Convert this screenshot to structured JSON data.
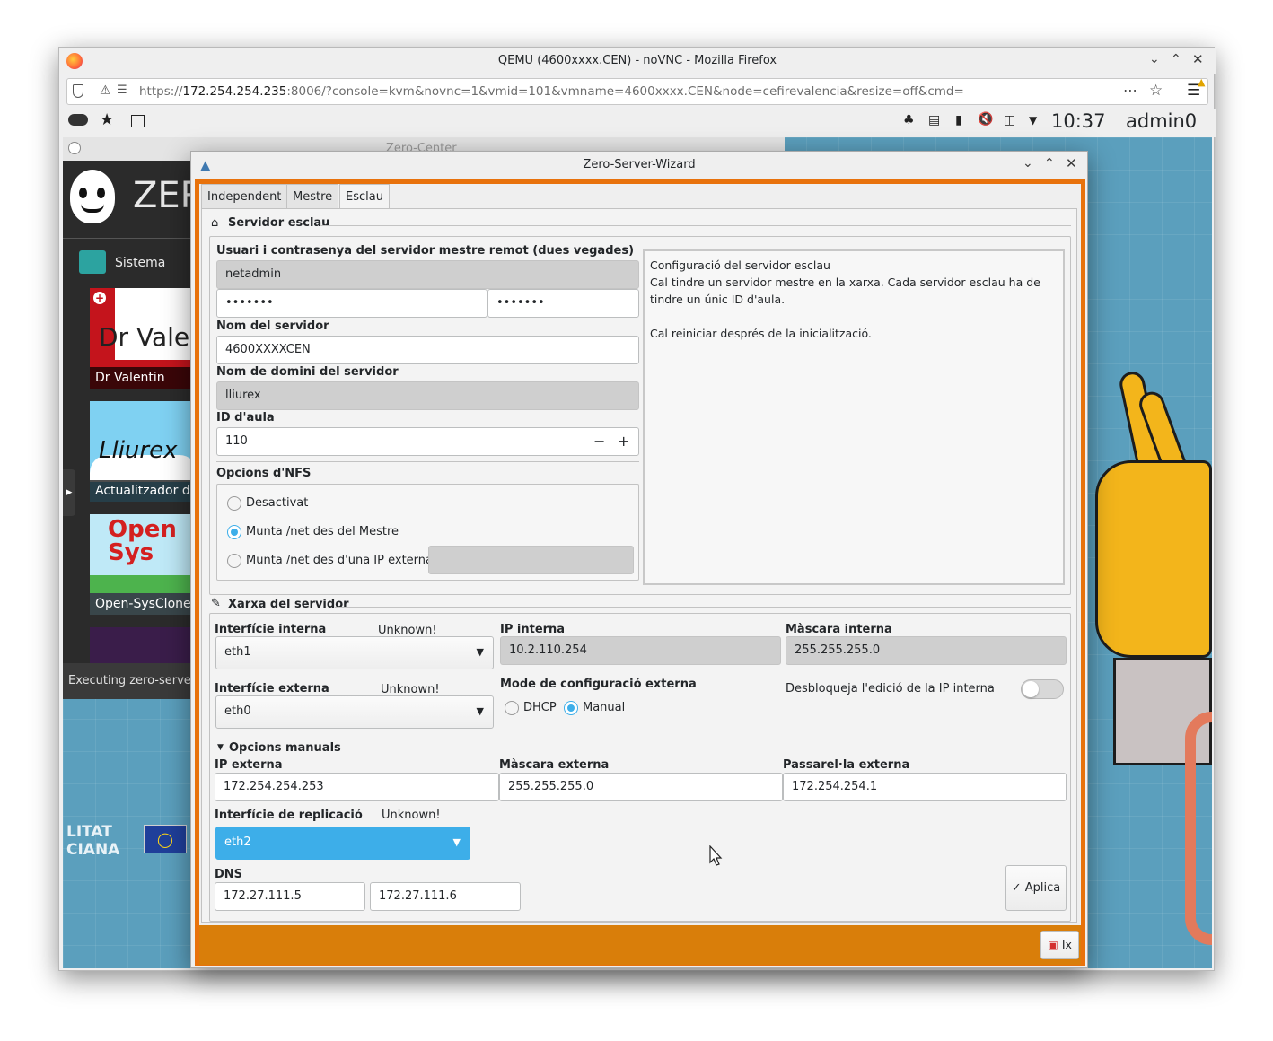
{
  "firefox": {
    "title": "QEMU (4600xxxx.CEN) - noVNC - Mozilla Firefox",
    "url_prefix": "https://",
    "url_host": "172.254.254.235",
    "url_rest": ":8006/?console=kvm&novnc=1&vmid=101&vmname=4600xxxx.CEN&node=cefirevalencia&resize=off&cmd="
  },
  "vm_panel": {
    "clock": "10:37",
    "user": "admin0"
  },
  "zero_center": {
    "title": "Zero-Center",
    "logo_text": "ZER",
    "category": "Sistema",
    "apps": [
      {
        "label": "Dr Valentin",
        "art": "Dr Vale"
      },
      {
        "label": "Actualitzador de",
        "art": "Lliurex"
      },
      {
        "label": "Open-SysClone",
        "art": "Open Sys"
      }
    ],
    "status": "Executing zero-server-",
    "footer_text_1": "LITAT",
    "footer_text_2": "CIANA"
  },
  "wizard": {
    "title": "Zero-Server-Wizard",
    "tabs": [
      "Independent",
      "Mestre",
      "Esclau"
    ],
    "active_tab": "Esclau",
    "section_slave": "Servidor esclau",
    "credentials_label": "Usuari i contrasenya del servidor mestre remot (dues vegades)",
    "username": "netadmin",
    "password1": "•••••••",
    "password2": "•••••••",
    "server_name_label": "Nom del servidor",
    "server_name": "4600XXXXCEN",
    "domain_label": "Nom de domini del servidor",
    "domain": "lliurex",
    "classroom_label": "ID d'aula",
    "classroom_id": "110",
    "nfs_label": "Opcions d'NFS",
    "nfs_options": [
      "Desactivat",
      "Munta /net des del Mestre",
      "Munta /net des d'una IP externa"
    ],
    "nfs_selected": "Munta /net des del Mestre",
    "info_lines": [
      "Configuració del servidor esclau",
      "Cal tindre un servidor mestre en la xarxa. Cada servidor esclau ha de",
      "tindre un únic ID d'aula.",
      "",
      "Cal reiniciar després de la inicialització."
    ],
    "section_network": "Xarxa del servidor",
    "internal_iface_label": "Interfície interna",
    "internal_iface_status": "Unknown!",
    "internal_iface": "eth1",
    "internal_ip_label": "IP interna",
    "internal_ip": "10.2.110.254",
    "internal_mask_label": "Màscara interna",
    "internal_mask": "255.255.255.0",
    "external_iface_label": "Interfície externa",
    "external_iface_status": "Unknown!",
    "external_iface": "eth0",
    "ext_mode_label": "Mode de configuració externa",
    "ext_mode_dhcp": "DHCP",
    "ext_mode_manual": "Manual",
    "ext_mode_selected": "Manual",
    "unlock_label": "Desbloqueja l'edició de la IP interna",
    "unlock_on": false,
    "manual_options_label": "Opcions manuals",
    "ext_ip_label": "IP externa",
    "ext_ip": "172.254.254.253",
    "ext_mask_label": "Màscara externa",
    "ext_mask": "255.255.255.0",
    "ext_gw_label": "Passarel·la externa",
    "ext_gw": "172.254.254.1",
    "repl_iface_label": "Interfície de replicació",
    "repl_iface_status": "Unknown!",
    "repl_iface": "eth2",
    "dns_label": "DNS",
    "dns1": "172.27.111.5",
    "dns2": "172.27.111.6",
    "apply_label": "Aplica",
    "exit_label": "Ix",
    "colors": {
      "frame": "#e8720c",
      "footer": "#d97e0a",
      "accent": "#3daee9"
    }
  }
}
